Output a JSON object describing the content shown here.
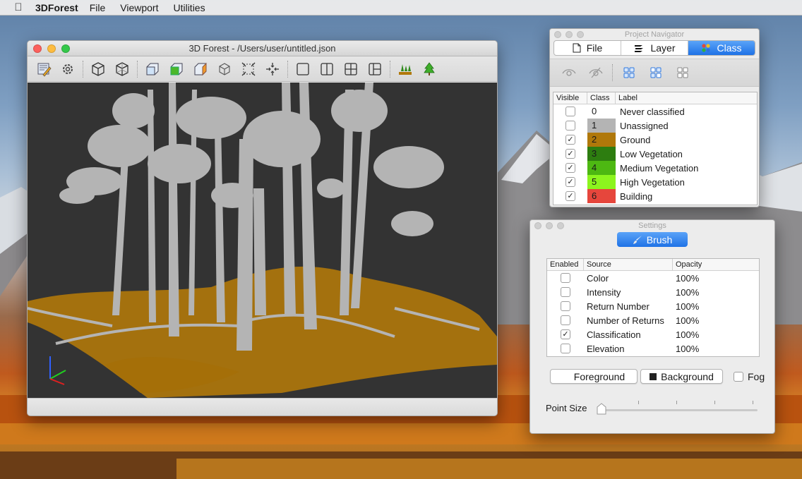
{
  "menubar": {
    "app_name": "3DForest",
    "items": [
      "File",
      "Viewport",
      "Utilities"
    ]
  },
  "main_window": {
    "title": "3D Forest - /Users/user/untitled.json",
    "toolbar_icons": [
      "layers-edit-icon",
      "settings-gear-icon",
      "cube-outline-icon",
      "cube-wireframe-icon",
      "cube-front-view-icon",
      "cube-top-view-icon",
      "cube-side-view-icon",
      "cube-iso-view-icon",
      "fit-screen-icon",
      "center-target-icon",
      "single-viewport-icon",
      "two-viewports-icon",
      "four-viewports-icon",
      "three-viewports-icon",
      "ground-segmentation-icon",
      "tree-segmentation-icon"
    ]
  },
  "navigator": {
    "title": "Project Navigator",
    "tabs": [
      {
        "label": "File",
        "icon": "file-icon",
        "active": false
      },
      {
        "label": "Layer",
        "icon": "layers-icon",
        "active": false
      },
      {
        "label": "Class",
        "icon": "class-palette-icon",
        "active": true
      }
    ],
    "headers": {
      "visible": "Visible",
      "class": "Class",
      "label": "Label"
    },
    "classes": [
      {
        "class": "0",
        "label": "Never classified",
        "visible": false,
        "color": "#ffffff"
      },
      {
        "class": "1",
        "label": "Unassigned",
        "visible": false,
        "color": "#b4b4b4"
      },
      {
        "class": "2",
        "label": "Ground",
        "visible": true,
        "color": "#b0780a"
      },
      {
        "class": "3",
        "label": "Low Vegetation",
        "visible": true,
        "color": "#2d7d10"
      },
      {
        "class": "4",
        "label": "Medium Vegetation",
        "visible": true,
        "color": "#4db812"
      },
      {
        "class": "5",
        "label": "High Vegetation",
        "visible": true,
        "color": "#8cf51e"
      },
      {
        "class": "6",
        "label": "Building",
        "visible": true,
        "color": "#e6463c"
      }
    ]
  },
  "settings": {
    "title": "Settings",
    "brush_label": "Brush",
    "headers": {
      "enabled": "Enabled",
      "source": "Source",
      "opacity": "Opacity"
    },
    "sources": [
      {
        "name": "Color",
        "opacity": "100%",
        "enabled": false
      },
      {
        "name": "Intensity",
        "opacity": "100%",
        "enabled": false
      },
      {
        "name": "Return Number",
        "opacity": "100%",
        "enabled": false
      },
      {
        "name": "Number of Returns",
        "opacity": "100%",
        "enabled": false
      },
      {
        "name": "Classification",
        "opacity": "100%",
        "enabled": true
      },
      {
        "name": "Elevation",
        "opacity": "100%",
        "enabled": false
      }
    ],
    "foreground_label": "Foreground",
    "background_label": "Background",
    "fog_label": "Fog",
    "fog_checked": false,
    "point_size_label": "Point Size",
    "point_size_value": 0
  },
  "colors": {
    "accent": "#1f72e6",
    "viewport_bg": "#333333",
    "trunk_gray": "#b4b4b4",
    "ground_brown": "#b0780a"
  }
}
